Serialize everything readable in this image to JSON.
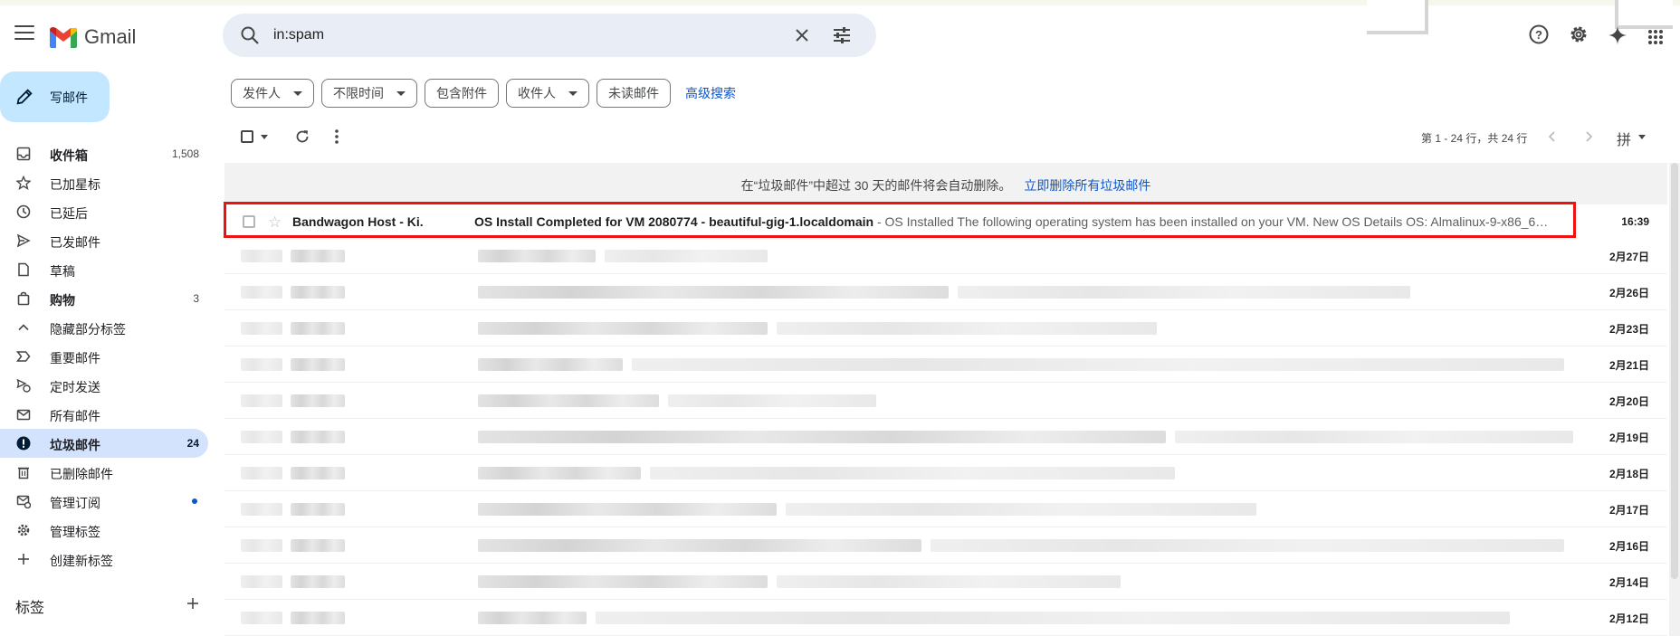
{
  "app": {
    "name": "Gmail"
  },
  "search": {
    "value": "in:spam"
  },
  "compose": {
    "label": "写邮件"
  },
  "nav": [
    {
      "label": "收件箱",
      "count": "1,508",
      "bold": true,
      "icon": "inbox-icon"
    },
    {
      "label": "已加星标",
      "count": "",
      "icon": "star-icon"
    },
    {
      "label": "已延后",
      "count": "",
      "icon": "clock-icon"
    },
    {
      "label": "已发邮件",
      "count": "",
      "icon": "send-icon"
    },
    {
      "label": "草稿",
      "count": "",
      "icon": "draft-icon"
    },
    {
      "label": "购物",
      "count": "3",
      "bold": true,
      "icon": "shopping-icon"
    },
    {
      "label": "隐藏部分标签",
      "count": "",
      "icon": "chevron-up-icon"
    },
    {
      "label": "重要邮件",
      "count": "",
      "icon": "important-icon"
    },
    {
      "label": "定时发送",
      "count": "",
      "icon": "scheduled-icon"
    },
    {
      "label": "所有邮件",
      "count": "",
      "icon": "all-mail-icon"
    },
    {
      "label": "垃圾邮件",
      "count": "24",
      "bold": true,
      "active": true,
      "icon": "spam-icon"
    },
    {
      "label": "已删除邮件",
      "count": "",
      "icon": "trash-icon"
    },
    {
      "label": "管理订阅",
      "count": "",
      "dot": true,
      "icon": "subscriptions-icon"
    },
    {
      "label": "管理标签",
      "count": "",
      "icon": "manage-labels-icon"
    },
    {
      "label": "创建新标签",
      "count": "",
      "icon": "plus-icon"
    }
  ],
  "labels_heading": "标签",
  "filters": {
    "chips": [
      {
        "label": "发件人",
        "dropdown": true
      },
      {
        "label": "不限时间",
        "dropdown": true
      },
      {
        "label": "包含附件",
        "dropdown": false
      },
      {
        "label": "收件人",
        "dropdown": true
      },
      {
        "label": "未读邮件",
        "dropdown": false
      }
    ],
    "advanced": "高级搜索"
  },
  "toolbar": {
    "pager": "第 1 - 24 行，共 24 行",
    "input_tool": "拼"
  },
  "notice": {
    "text": "在“垃圾邮件”中超过 30 天的邮件将会自动删除。",
    "link": "立即删除所有垃圾邮件"
  },
  "emails": [
    {
      "sender": "Bandwagon Host - Ki.",
      "subject": "OS Install Completed for VM 2080774 - beautiful-gig-1.localdomain",
      "snippet": " - OS Installed The following operating system has been installed on your VM. New OS Details OS: Almalinux-9-x86_6…",
      "date": "16:39",
      "highlighted": true
    },
    {
      "date": "2月27日"
    },
    {
      "date": "2月26日"
    },
    {
      "date": "2月23日"
    },
    {
      "date": "2月21日"
    },
    {
      "date": "2月20日"
    },
    {
      "date": "2月19日"
    },
    {
      "date": "2月18日"
    },
    {
      "date": "2月17日"
    },
    {
      "date": "2月16日"
    },
    {
      "date": "2月14日"
    },
    {
      "date": "2月12日"
    }
  ]
}
